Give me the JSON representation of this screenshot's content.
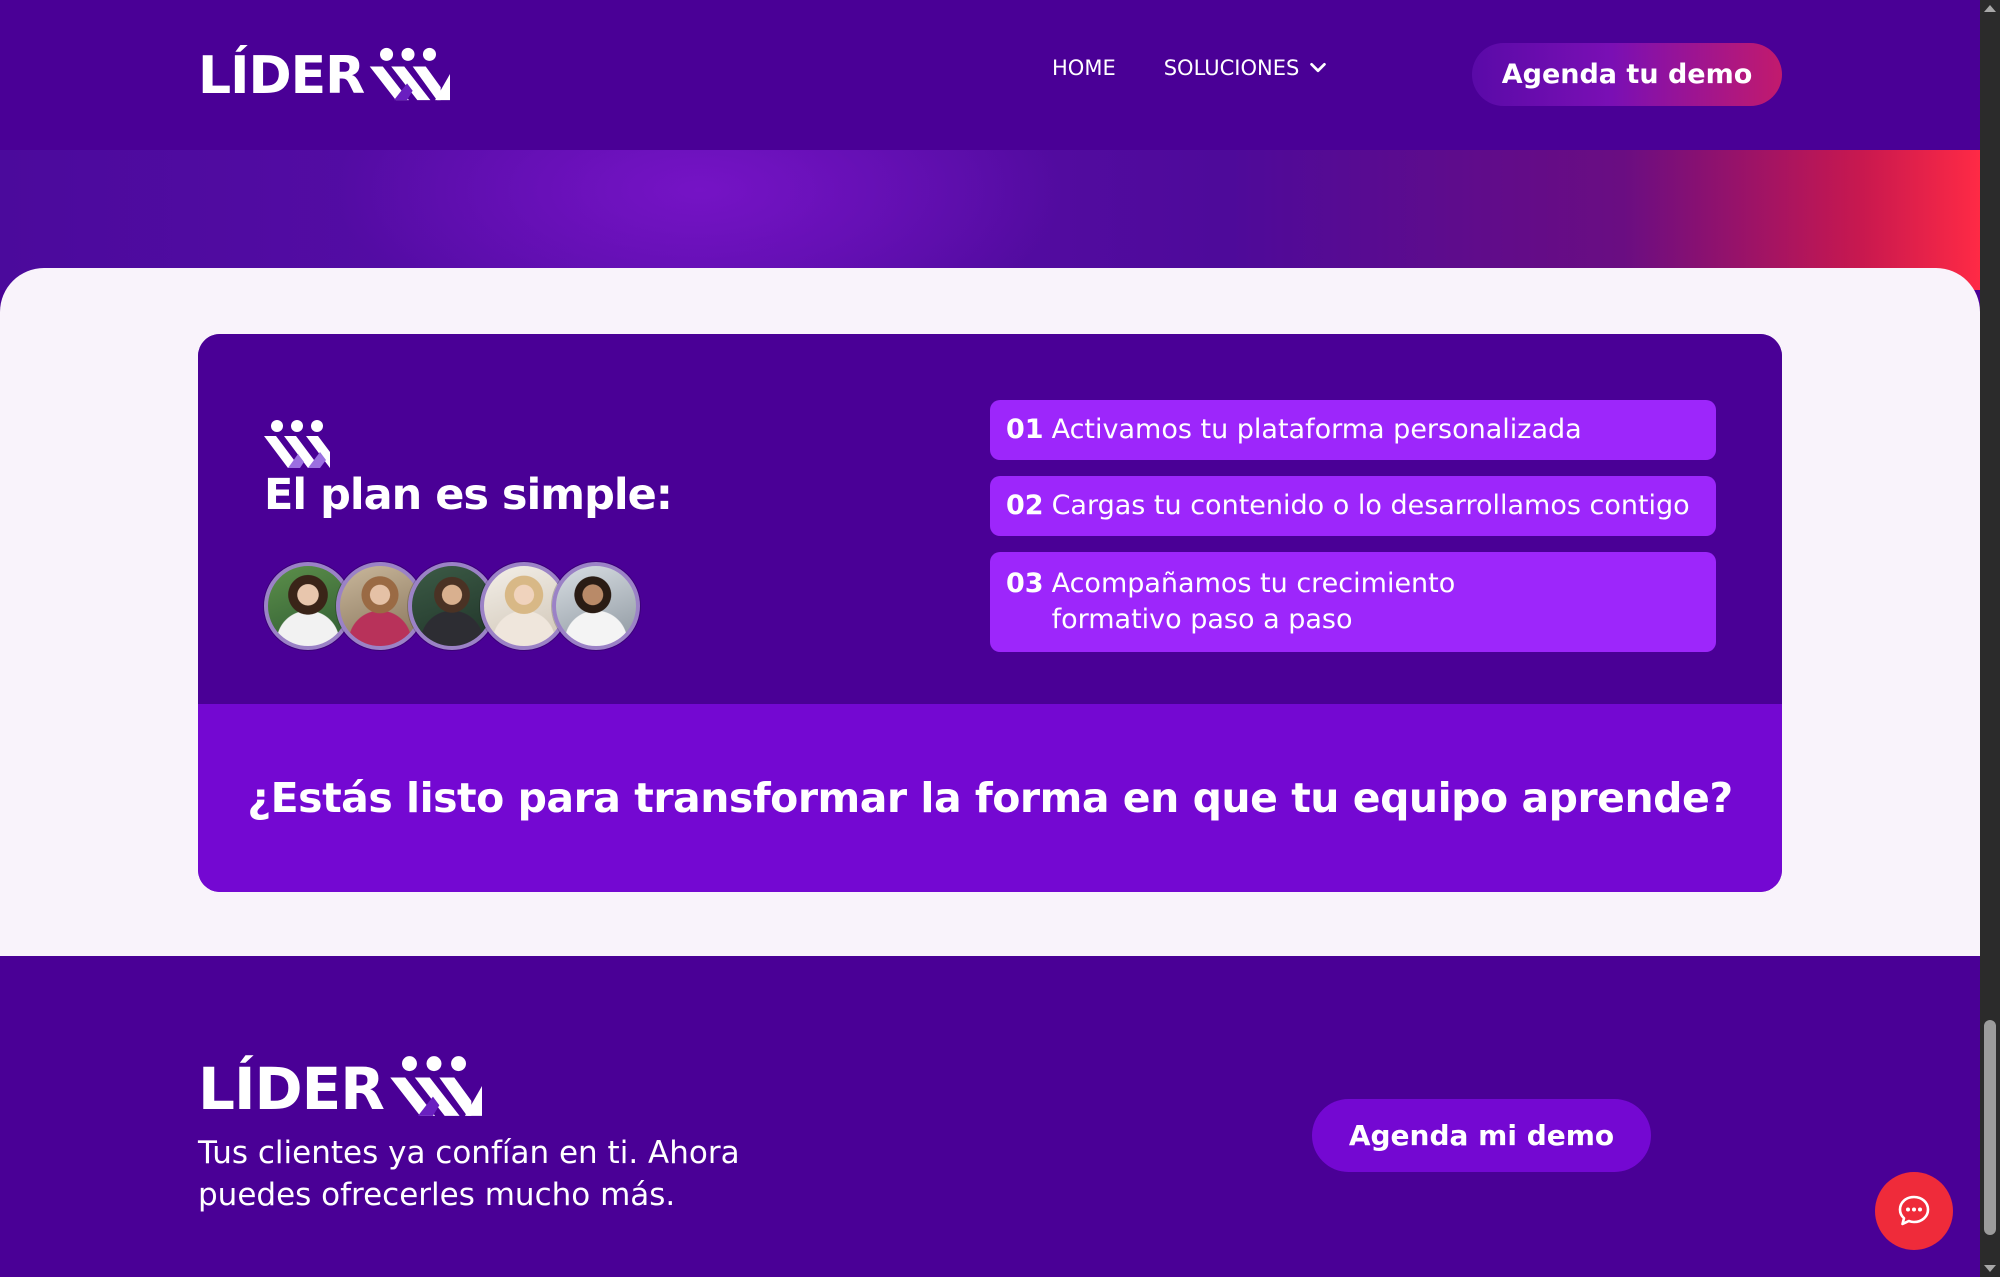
{
  "header": {
    "logo_text": "LÍDER",
    "nav": [
      {
        "label": "HOME"
      },
      {
        "label": "SOLUCIONES"
      }
    ],
    "cta_label": "Agenda tu demo"
  },
  "plan": {
    "title": "El plan es simple:",
    "steps": [
      {
        "number": "01",
        "text": "Activamos tu plataforma personalizada"
      },
      {
        "number": "02",
        "text": "Cargas tu contenido o lo desarrollamos contigo"
      },
      {
        "number": "03",
        "text": "Acompañamos tu crecimiento formativo paso a paso"
      }
    ],
    "question": "¿Estás listo para transformar la forma en que tu equipo aprende?"
  },
  "footer": {
    "logo_text": "LÍDER",
    "tagline": "Tus clientes ya confían en ti. Ahora puedes ofrecerles mucho más.",
    "cta_label": "Agenda mi demo"
  },
  "colors": {
    "brand_purple": "#4a0096",
    "accent_violet": "#9d26fb",
    "bright_purple": "#7408d2",
    "accent_red": "#ef2b3a"
  },
  "icons": [
    "lider-logo-mark-icon",
    "chevron-down-icon",
    "chat-bubble-icon"
  ]
}
